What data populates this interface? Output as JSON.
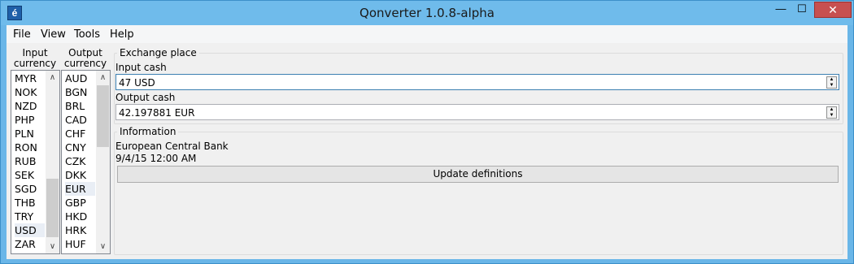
{
  "window": {
    "title": "Qonverter 1.0.8-alpha",
    "icon_glyph": "é",
    "minimize_glyph": "—",
    "maximize_glyph": "☐",
    "close_glyph": "✕"
  },
  "menu": {
    "file": "File",
    "view": "View",
    "tools": "Tools",
    "help": "Help"
  },
  "input_currency": {
    "header_line1": "Input",
    "header_line2": "currency",
    "items": [
      "MYR",
      "NOK",
      "NZD",
      "PHP",
      "PLN",
      "RON",
      "RUB",
      "SEK",
      "SGD",
      "THB",
      "TRY",
      "USD",
      "ZAR"
    ],
    "selected": "USD"
  },
  "output_currency": {
    "header_line1": "Output",
    "header_line2": "currency",
    "items": [
      "AUD",
      "BGN",
      "BRL",
      "CAD",
      "CHF",
      "CNY",
      "CZK",
      "DKK",
      "EUR",
      "GBP",
      "HKD",
      "HRK",
      "HUF"
    ],
    "selected": "EUR"
  },
  "exchange": {
    "title": "Exchange place",
    "input_label": "Input cash",
    "input_value": "47 USD",
    "output_label": "Output cash",
    "output_value": "42.197881 EUR"
  },
  "information": {
    "title": "Information",
    "source": "European Central Bank",
    "date": "9/4/15 12:00 AM",
    "update_button": "Update definitions"
  },
  "scroll": {
    "up_glyph": "▲",
    "down_glyph": "▼",
    "list_up_glyph": "∧",
    "list_down_glyph": "∨"
  },
  "colors": {
    "titlebar": "#6fbbeb",
    "close_button": "#c75050",
    "selection": "#e9eef5",
    "focus_border": "#3c7fb1"
  }
}
